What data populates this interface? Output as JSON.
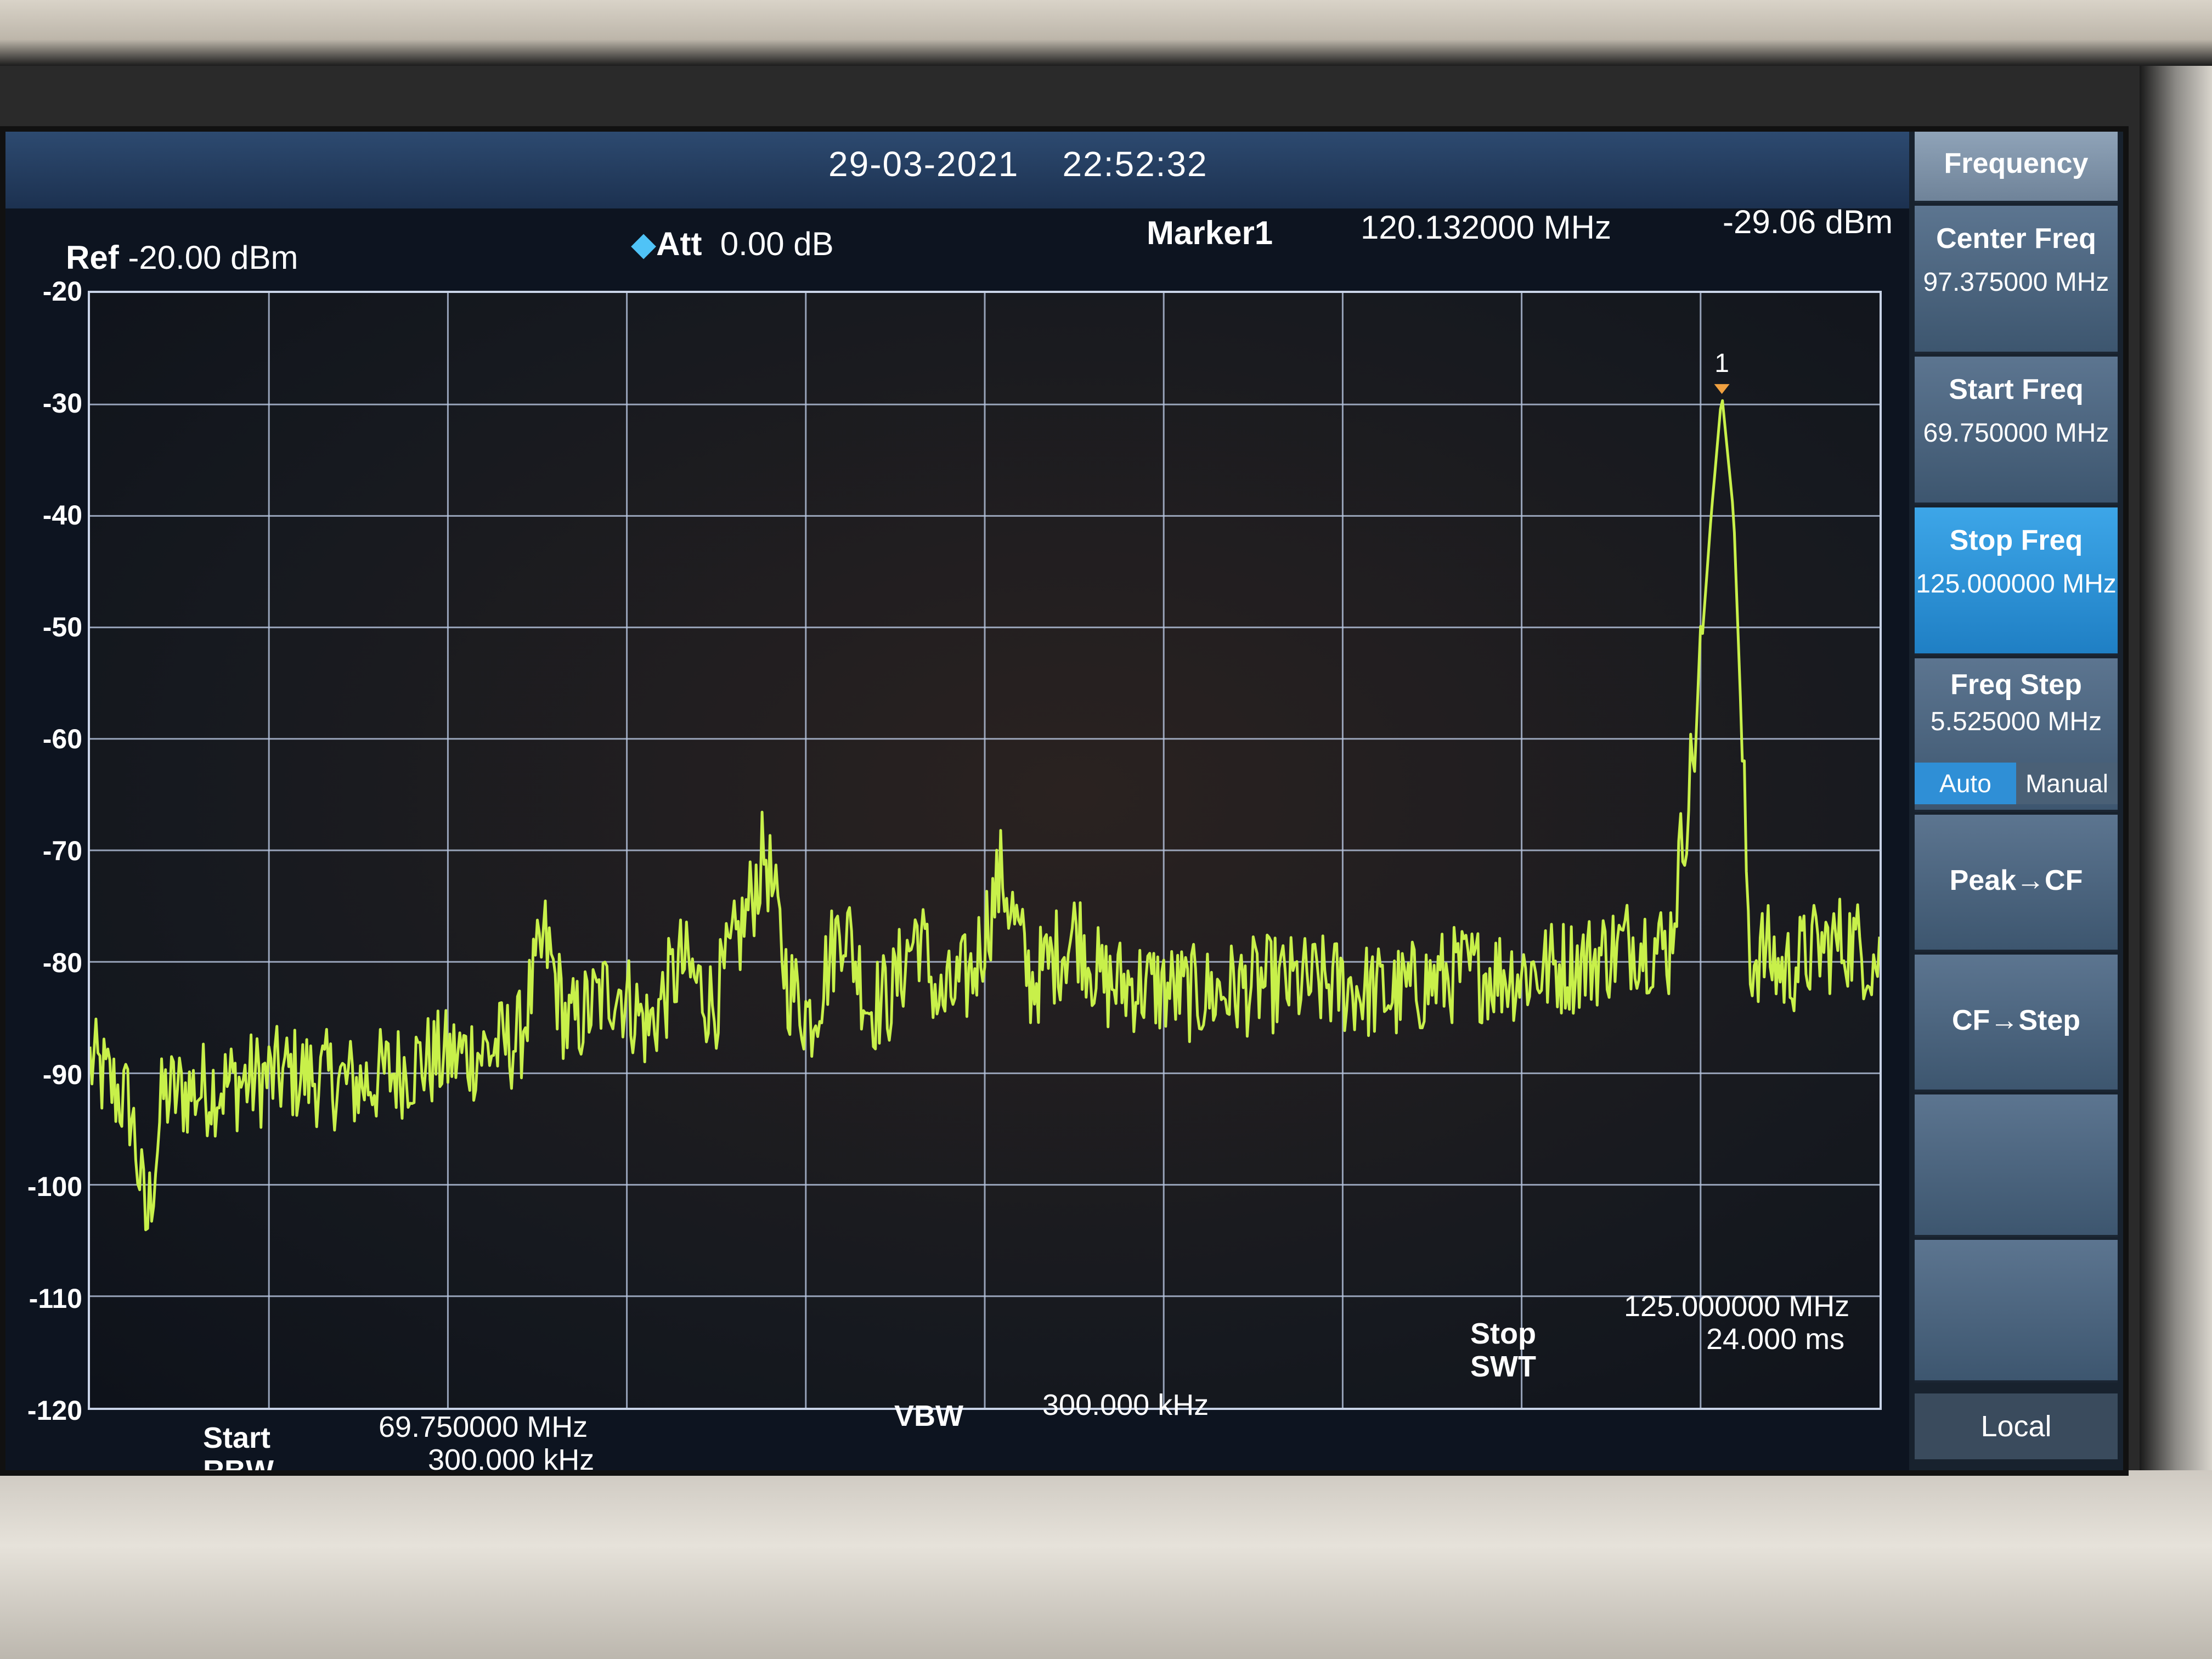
{
  "header": {
    "date": "29-03-2021",
    "time": "22:52:32",
    "ref_label": "Ref",
    "ref_value": "-20.00 dBm",
    "att_label": "Att",
    "att_value": "0.00 dB",
    "marker_label": "Marker1",
    "marker_freq": "120.132000 MHz",
    "marker_level": "-29.06 dBm",
    "marker_tag": "1"
  },
  "softkeys": {
    "title": "Frequency",
    "center_freq": {
      "label": "Center Freq",
      "value": "97.375000 MHz"
    },
    "start_freq": {
      "label": "Start Freq",
      "value": "69.750000 MHz"
    },
    "stop_freq": {
      "label": "Stop Freq",
      "value": "125.000000 MHz"
    },
    "freq_step": {
      "label": "Freq Step",
      "value": "5.525000 MHz",
      "auto": "Auto",
      "manual": "Manual",
      "selected": "Auto"
    },
    "peak_cf": "Peak→CF",
    "cf_step": "CF→Step",
    "local": "Local"
  },
  "footer": {
    "start_label": "Start",
    "start_value": "69.750000 MHz",
    "rbw_label": "RBW",
    "rbw_value": "300.000 kHz",
    "vbw_label": "VBW",
    "vbw_value": "300.000 kHz",
    "stop_label": "Stop",
    "stop_value": "125.000000 MHz",
    "swt_label": "SWT",
    "swt_value": "24.000 ms"
  },
  "colors": {
    "trace": "#c8f04a",
    "grid": "#b8c6e0",
    "active_key": "#2f8fd6"
  },
  "chart_data": {
    "type": "line",
    "xlim": [
      69.75,
      125.0
    ],
    "ylim": [
      -120,
      -20
    ],
    "yticks": [
      "-20",
      "-30",
      "-40",
      "-50",
      "-60",
      "-70",
      "-80",
      "-90",
      "-100",
      "-110",
      "-120"
    ],
    "grid": true,
    "series": [
      {
        "x": [
          69.75,
          71.0,
          71.5,
          72.0,
          74.0,
          76.0,
          78.0,
          80.0,
          82.0,
          83.0,
          83.8,
          84.5,
          86.0,
          87.0,
          88.0,
          89.0,
          90.0,
          90.6,
          91.3,
          92.0,
          93.0,
          93.8,
          94.5,
          95.3,
          96.0,
          97.0,
          97.9,
          98.8,
          100.0,
          100.2,
          101.0,
          102.0,
          104.0,
          106.0,
          108.0,
          110.0,
          112.0,
          114.0,
          116.0,
          117.5,
          118.5,
          119.3,
          119.8,
          120.13,
          120.5,
          121.0,
          121.5,
          122.0,
          123.0,
          124.0,
          125.0
        ],
        "y": [
          -89,
          -93,
          -104,
          -92,
          -91,
          -90,
          -91,
          -89,
          -88,
          -87,
          -78,
          -86,
          -82,
          -86,
          -80,
          -84,
          -76,
          -70,
          -82,
          -85,
          -76,
          -84,
          -83,
          -77,
          -84,
          -81,
          -72,
          -82,
          -78,
          -77,
          -82,
          -82,
          -83,
          -82,
          -82,
          -83,
          -81,
          -81,
          -80,
          -78,
          -79,
          -60,
          -40,
          -29.06,
          -40,
          -80,
          -79,
          -81,
          -79,
          -78,
          -80
        ]
      }
    ],
    "marker": {
      "x": 120.132,
      "y": -29.06,
      "label": "1"
    }
  }
}
